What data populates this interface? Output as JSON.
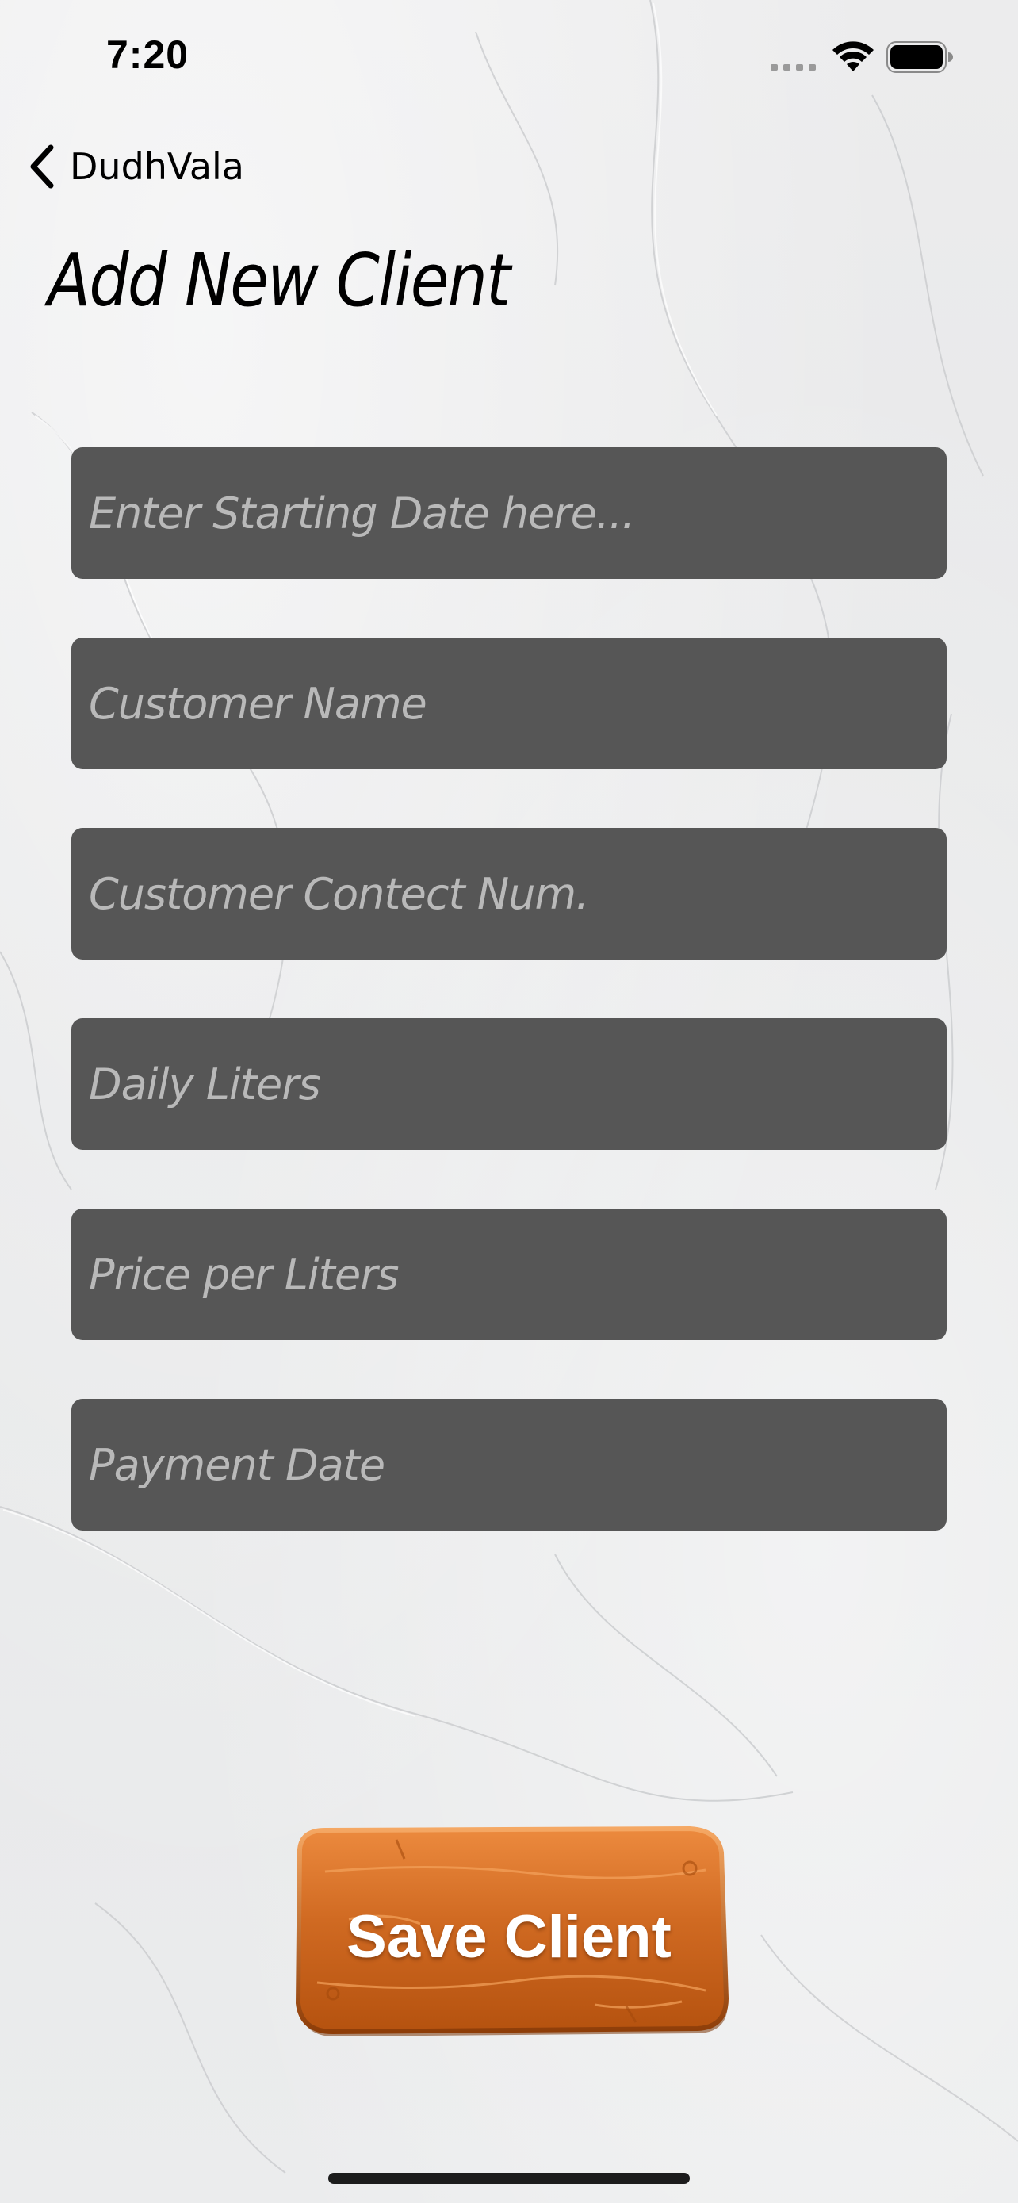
{
  "status_bar": {
    "time": "7:20",
    "icons": [
      "cellular-signal-icon",
      "wifi-icon",
      "battery-icon"
    ]
  },
  "nav": {
    "back_label": "DudhVala",
    "back_icon": "chevron-left-icon"
  },
  "page": {
    "title": "Add New Client"
  },
  "form": {
    "fields": [
      {
        "placeholder": "Enter Starting Date here...",
        "value": ""
      },
      {
        "placeholder": "Customer Name",
        "value": ""
      },
      {
        "placeholder": "Customer Contect Num.",
        "value": ""
      },
      {
        "placeholder": "Daily Liters",
        "value": ""
      },
      {
        "placeholder": "Price per Liters",
        "value": ""
      },
      {
        "placeholder": "Payment Date",
        "value": ""
      }
    ],
    "field_color": "#565656",
    "placeholder_color": "#b9b9b9"
  },
  "actions": {
    "save_label": "Save Client",
    "save_color": "#c8621a"
  }
}
